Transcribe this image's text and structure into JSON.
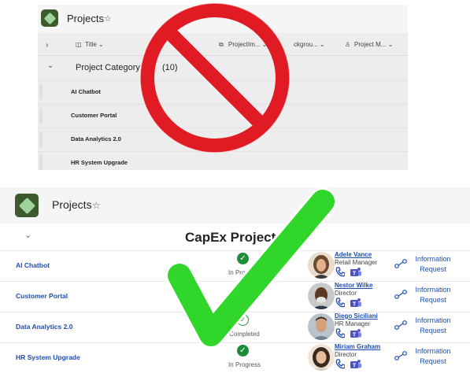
{
  "top_panel": {
    "title": "Projects",
    "star": "☆",
    "expand_glyph": "›",
    "columns": [
      {
        "icon": "◫",
        "label": "Title ⌄"
      },
      {
        "icon": "⧉",
        "label": "ProjectIm... ⌄"
      },
      {
        "icon": "",
        "label": "ckgrou... ⌄"
      },
      {
        "icon": "♙",
        "label": "Project M... ⌄"
      }
    ],
    "group_chevron": "⌄",
    "group_label": "Project Category: C",
    "group_count": "(10)",
    "rows": [
      "AI Chatbot",
      "Customer Portal",
      "Data Analytics 2.0",
      "HR System Upgrade"
    ]
  },
  "bottom_panel": {
    "title": "Projects",
    "star": "☆",
    "group_chevron": "⌄",
    "group_title": "CapEx Projects",
    "rows": [
      {
        "project": "AI Chatbot",
        "status_icon": "✓",
        "status": "In Progress",
        "manager": "Adele Vance",
        "role": "Retail Manager",
        "link": "Information Request"
      },
      {
        "project": "Customer Portal",
        "status_icon": "",
        "status": "",
        "manager": "Nestor Wilke",
        "role": "Director",
        "link": "Information Request"
      },
      {
        "project": "Data Analytics 2.0",
        "status_icon": "✓",
        "status": "Completed",
        "manager": "Diego Siciliani",
        "role": "HR Manager",
        "link": "Information Request"
      },
      {
        "project": "HR System Upgrade",
        "status_icon": "✓",
        "status": "In Progress",
        "manager": "Miriam Graham",
        "role": "Director",
        "link": "Information Request"
      }
    ]
  },
  "colors": {
    "accent": "#1e4fb0",
    "status_green": "#1e8d3a",
    "prohibit_red": "#e01b24",
    "check_green": "#31d62a"
  }
}
